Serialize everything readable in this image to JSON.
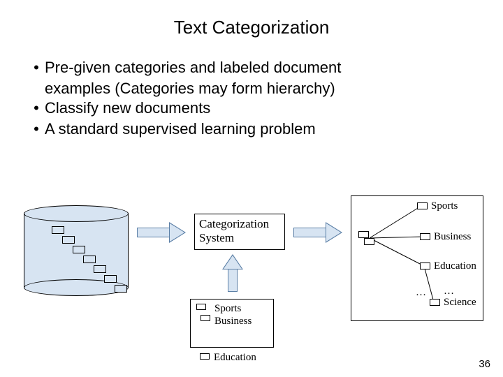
{
  "title": "Text Categorization",
  "bullets": {
    "b1a": "Pre-given categories and labeled document",
    "b1b": "examples (Categories may form hierarchy)",
    "b2": "Classify new documents",
    "b3": "A standard supervised learning problem"
  },
  "system_box": {
    "line1": "Categorization",
    "line2": "System"
  },
  "tree": {
    "sports": "Sports",
    "business": "Business",
    "education": "Education",
    "science": "Science",
    "ellipsis": "…"
  },
  "training": {
    "line1": "Sports",
    "line2": "Business",
    "line3": "Education"
  },
  "page_number": "36"
}
